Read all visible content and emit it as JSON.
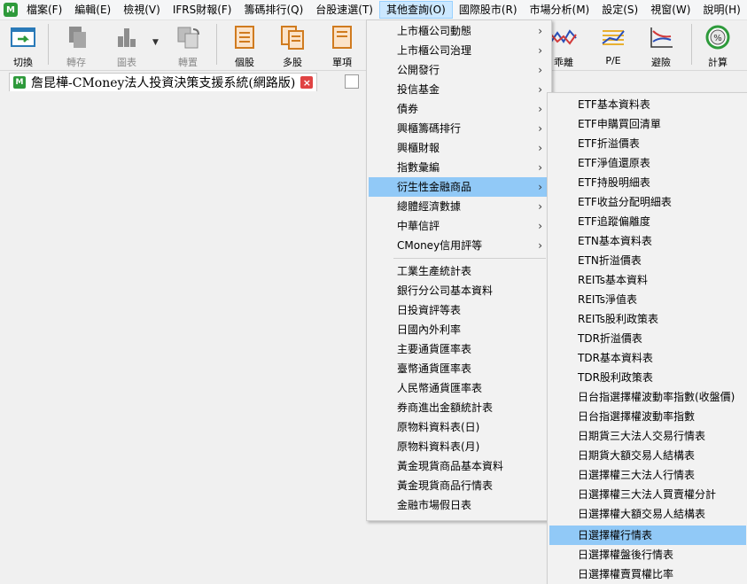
{
  "menubar": {
    "app_icon": "M",
    "items": [
      "檔案(F)",
      "編輯(E)",
      "檢視(V)",
      "IFRS財報(F)",
      "籌碼排行(Q)",
      "台股速選(T)",
      "其他查詢(O)",
      "國際股市(R)",
      "市場分析(M)",
      "設定(S)",
      "視窗(W)",
      "說明(H)"
    ],
    "active_index": 6
  },
  "toolbar": {
    "buttons": [
      {
        "label": "切換",
        "icon": "switch-icon",
        "enabled": true
      },
      {
        "label": "轉存",
        "icon": "export-icon",
        "enabled": false
      },
      {
        "label": "圖表",
        "icon": "chart-icon",
        "enabled": false
      },
      {
        "label": "轉置",
        "icon": "transpose-icon",
        "enabled": false
      },
      {
        "label": "個股",
        "icon": "single-stock-icon",
        "enabled": true
      },
      {
        "label": "多股",
        "icon": "multi-stock-icon",
        "enabled": true
      },
      {
        "label": "單項",
        "icon": "single-item-icon",
        "enabled": true
      },
      {
        "label": "乖離",
        "icon": "deviation-icon",
        "enabled": true
      },
      {
        "label": "P/E",
        "icon": "pe-icon",
        "enabled": true
      },
      {
        "label": "避險",
        "icon": "hedge-icon",
        "enabled": true
      },
      {
        "label": "計算",
        "icon": "calculator-icon",
        "enabled": true
      }
    ]
  },
  "tab": {
    "icon": "M",
    "title": "詹昆樺-CMoney法人投資決策支援系統(網路版)",
    "close_glyph": "×"
  },
  "dropdown": {
    "submenu_items": [
      "上市櫃公司動態",
      "上市櫃公司治理",
      "公開發行",
      "投信基金",
      "債券",
      "興櫃籌碼排行",
      "興櫃財報",
      "指數彙編",
      "衍生性金融商品",
      "總體經濟數據",
      "中華信評",
      "CMoney信用評等"
    ],
    "highlighted_index": 8,
    "plain_items": [
      "工業生產統計表",
      "銀行分公司基本資料",
      "日投資評等表",
      "日國內外利率",
      "主要通貨匯率表",
      "臺幣通貨匯率表",
      "人民幣通貨匯率表",
      "券商進出金額統計表",
      "原物料資料表(日)",
      "原物料資料表(月)",
      "黃金現貨商品基本資料",
      "黃金現貨商品行情表",
      "金融市場假日表"
    ],
    "arrow": "›"
  },
  "submenu": {
    "items": [
      "ETF基本資料表",
      "ETF申購買回清單",
      "ETF折溢價表",
      "ETF淨值還原表",
      "ETF持股明細表",
      "ETF收益分配明細表",
      "ETF追蹤偏離度",
      "ETN基本資料表",
      "ETN折溢價表",
      "REITs基本資料",
      "REITs淨值表",
      "REITs股利政策表",
      "TDR折溢價表",
      "TDR基本資料表",
      "TDR股利政策表",
      "日台指選擇權波動率指數(收盤價)",
      "日台指選擇權波動率指數",
      "日期貨三大法人交易行情表",
      "日期貨大額交易人結構表",
      "日選擇權三大法人行情表",
      "日選擇權三大法人買賣權分計",
      "日選擇權大額交易人結構表",
      "日選擇權行情表",
      "日選擇權盤後行情表",
      "日選擇權賣買權比率"
    ],
    "highlighted_index": 22
  }
}
